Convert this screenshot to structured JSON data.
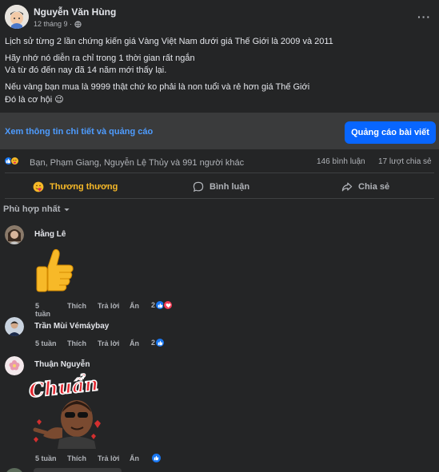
{
  "post": {
    "author": "Nguyễn Văn Hùng",
    "time": "12 tháng 9 ·",
    "lines": [
      "Lịch sử từng 2 lần chứng kiến giá Vàng Việt Nam dưới giá Thế Giới là 2009 và 2011",
      "Hãy nhớ nó diễn ra chỉ trong 1 thời gian rất ngắn",
      "Và từ đó đến nay đã 14 năm mới thấy lại.",
      "Nếu vàng bạn mua là 9999 thật chứ ko phải là non tuổi và rẻ hơn giá Thế Giới",
      "Đó là cơ hội 😉"
    ]
  },
  "promo": {
    "link": "Xem thông tin chi tiết và quảng cáo",
    "button": "Quảng cáo bài viết"
  },
  "stats": {
    "reactors": "Bạn, Phạm Giang, Nguyễn Lệ Thủy và 991 người khác",
    "comments": "146 bình luận",
    "shares": "17 lượt chia sẻ"
  },
  "actions": {
    "react": "Thương thương",
    "comment": "Bình luận",
    "share": "Chia sẻ"
  },
  "sort": {
    "label": "Phù hợp nhất"
  },
  "comments": [
    {
      "name": "Hằng Lê",
      "time": "5 tuần",
      "like": "Thích",
      "reply": "Trả lời",
      "hide": "Ẩn",
      "count": "2"
    },
    {
      "name": "Trần Mùi Vémáybay",
      "time": "5 tuần",
      "like": "Thích",
      "reply": "Trả lời",
      "hide": "Ẩn",
      "count": "2"
    },
    {
      "name": "Thuận Nguyễn",
      "time": "5 tuần",
      "like": "Thích",
      "reply": "Trả lời",
      "hide": "Ẩn",
      "sticker_text": "Chuẩn"
    }
  ],
  "colors": {
    "bg": "#242526",
    "accent": "#0866ff",
    "react_yellow": "#f7b928",
    "text_muted": "#b0b3b8"
  }
}
